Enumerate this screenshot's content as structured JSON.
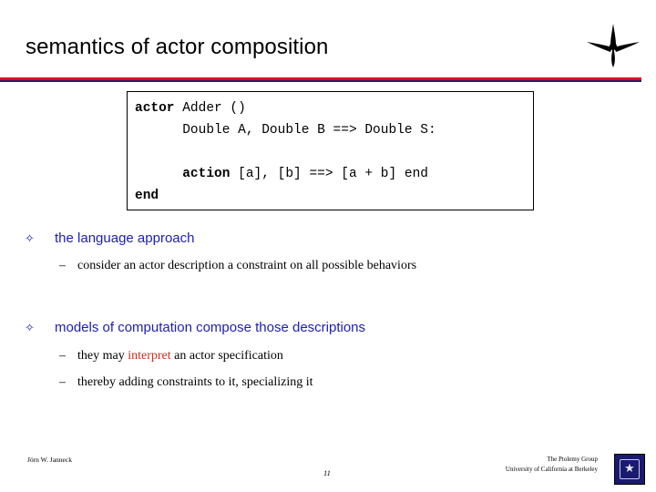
{
  "slide": {
    "title": "semantics of actor composition",
    "page_number": "11",
    "accent_color": "#e8001c",
    "bullet_color": "#1d1db5",
    "highlight_color": "#d52b1e"
  },
  "code_box": {
    "lines": [
      {
        "bold": "actor",
        "rest": " Adder ()"
      },
      {
        "bold": "",
        "rest": "      Double A, Double B ==> Double S:"
      },
      {
        "bold": "",
        "rest": ""
      },
      {
        "bold": "",
        "rest": "      ",
        "bold2": "action",
        "rest2": " [a], [b] ==> [a + b] end"
      },
      {
        "bold": "end",
        "rest": ""
      }
    ],
    "plain_text": "actor Adder ()\n      Double A, Double B ==> Double S:\n\n      action [a], [b] ==> [a + b] end\nend"
  },
  "bullets": [
    {
      "level1": "the language approach",
      "marker": "u",
      "sub": [
        {
          "dash": "–",
          "text": "consider an actor description a constraint on all possible behaviors"
        }
      ]
    },
    {
      "level1": "models of computation compose those descriptions",
      "marker": "u",
      "sub": [
        {
          "dash": "–",
          "text_pre": "they may ",
          "text_hl": "interpret",
          "text_post": " an actor specification"
        },
        {
          "dash": "–",
          "text": "thereby adding constraints to it, specializing it"
        }
      ]
    }
  ],
  "footer": {
    "author": "Jörn W. Janneck",
    "org_line1": "The Ptolemy Group",
    "org_line2": "University of California at Berkeley",
    "seal_glyph": "★"
  }
}
